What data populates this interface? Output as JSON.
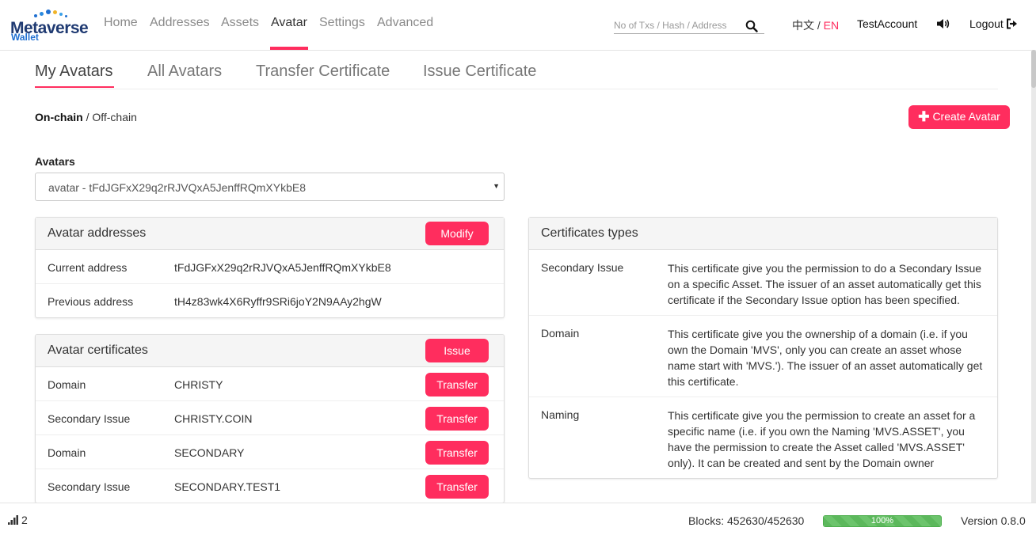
{
  "brand": {
    "name": "Metaverse",
    "sub": "Wallet"
  },
  "nav": {
    "items": [
      "Home",
      "Addresses",
      "Assets",
      "Avatar",
      "Settings",
      "Advanced"
    ],
    "active": "Avatar"
  },
  "search": {
    "placeholder": "No of Txs / Hash / Address"
  },
  "lang": {
    "zh": "中文",
    "sep": "/",
    "en": "EN"
  },
  "account": "TestAccount",
  "logout": "Logout",
  "tabs": [
    "My Avatars",
    "All Avatars",
    "Transfer Certificate",
    "Issue Certificate"
  ],
  "chain": {
    "onchain": "On-chain",
    "sep": "/",
    "offchain": "Off-chain"
  },
  "create_button": "Create Avatar",
  "avatars": {
    "label": "Avatars",
    "selected": "avatar - tFdJGFxX29q2rRJVQxA5JenffRQmXYkbE8"
  },
  "addresses_panel": {
    "title": "Avatar addresses",
    "button": "Modify",
    "rows": [
      {
        "label": "Current address",
        "value": "tFdJGFxX29q2rRJVQxA5JenffRQmXYkbE8"
      },
      {
        "label": "Previous address",
        "value": "tH4z83wk4X6Ryffr9SRi6joY2N9AAy2hgW"
      }
    ]
  },
  "certificates_panel": {
    "title": "Avatar certificates",
    "button": "Issue",
    "rows": [
      {
        "type": "Domain",
        "name": "CHRISTY",
        "action": "Transfer"
      },
      {
        "type": "Secondary Issue",
        "name": "CHRISTY.COIN",
        "action": "Transfer"
      },
      {
        "type": "Domain",
        "name": "SECONDARY",
        "action": "Transfer"
      },
      {
        "type": "Secondary Issue",
        "name": "SECONDARY.TEST1",
        "action": "Transfer"
      }
    ]
  },
  "cert_types_panel": {
    "title": "Certificates types",
    "rows": [
      {
        "type": "Secondary Issue",
        "desc": "This certificate give you the permission to do a Secondary Issue on a specific Asset. The issuer of an asset automatically get this certificate if the Secondary Issue option has been specified."
      },
      {
        "type": "Domain",
        "desc": "This certificate give you the ownership of a domain (i.e. if you own the Domain 'MVS', only you can create an asset whose name start with 'MVS.'). The issuer of an asset automatically get this certificate."
      },
      {
        "type": "Naming",
        "desc": "This certificate give you the permission to create an asset for a specific name (i.e. if you own the Naming 'MVS.ASSET', you have the permission to create the Asset called 'MVS.ASSET' only). It can be created and sent by the Domain owner"
      }
    ]
  },
  "footer": {
    "peers": "2",
    "blocks": "Blocks: 452630/452630",
    "progress_text": "100%",
    "progress_value": 100,
    "version": "Version 0.8.0"
  },
  "colors": {
    "accent": "#ff2d5e",
    "brand": "#1f3a72",
    "progress": "#5cb85c"
  }
}
